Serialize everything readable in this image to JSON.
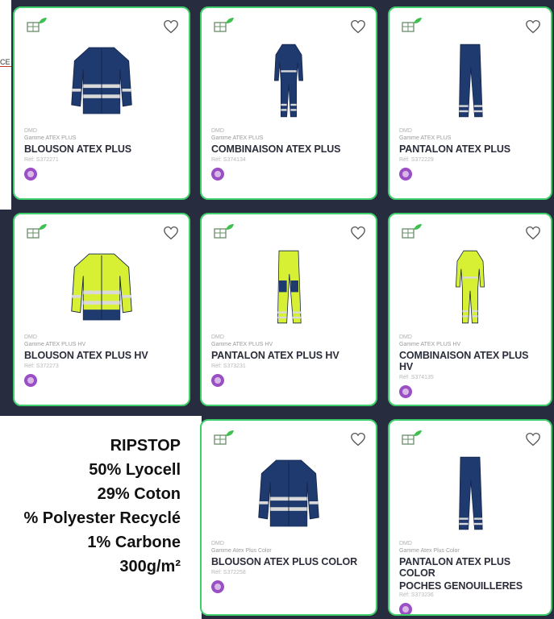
{
  "left_strip": {
    "text": "CE"
  },
  "spec_panel": {
    "lines": [
      "RIPSTOP",
      "50% Lyocell",
      "29% Coton",
      "% Polyester Recyclé",
      "1% Carbone",
      "300g/m²"
    ]
  },
  "colors": {
    "card_border": "#3fcf6a",
    "background": "#272c3e",
    "navy_garment": "#1f3a6e",
    "hivis_yellow": "#d8f033",
    "badge_purple": "#9b4fc4"
  },
  "products": [
    {
      "brand": "DMD",
      "range": "Gamme ATEX PLUS",
      "title": "BLOUSON ATEX PLUS",
      "title2": "",
      "ref": "Réf: S372271",
      "garment": "navy-jacket"
    },
    {
      "brand": "DMD",
      "range": "Gamme ATEX PLUS",
      "title": "COMBINAISON ATEX PLUS",
      "title2": "",
      "ref": "Réf: S374134",
      "garment": "navy-coverall"
    },
    {
      "brand": "DMD",
      "range": "Gamme ATEX PLUS",
      "title": "PANTALON ATEX PLUS",
      "title2": "",
      "ref": "Réf: S372229",
      "garment": "navy-trousers"
    },
    {
      "brand": "DMD",
      "range": "Gamme ATEX PLUS HV",
      "title": "BLOUSON ATEX PLUS HV",
      "title2": "",
      "ref": "Réf: S372273",
      "garment": "hivis-jacket"
    },
    {
      "brand": "DMD",
      "range": "Gamme ATEX PLUS HV",
      "title": "PANTALON ATEX PLUS HV",
      "title2": "",
      "ref": "Réf: S373231",
      "garment": "hivis-trousers"
    },
    {
      "brand": "DMD",
      "range": "Gamme ATEX PLUS HV",
      "title": "COMBINAISON ATEX PLUS HV",
      "title2": "",
      "ref": "Réf: S374135",
      "garment": "hivis-coverall"
    },
    {
      "brand": "DMD",
      "range": "Gamme Atex Plus Color",
      "title": "BLOUSON ATEX PLUS COLOR",
      "title2": "",
      "ref": "Réf: S372258",
      "garment": "navy-jacket"
    },
    {
      "brand": "DMD",
      "range": "Gamme Atex Plus Color",
      "title": "PANTALON ATEX PLUS COLOR",
      "title2": "POCHES GENOUILLERES",
      "ref": "Réf: S373236",
      "garment": "navy-trousers"
    }
  ]
}
